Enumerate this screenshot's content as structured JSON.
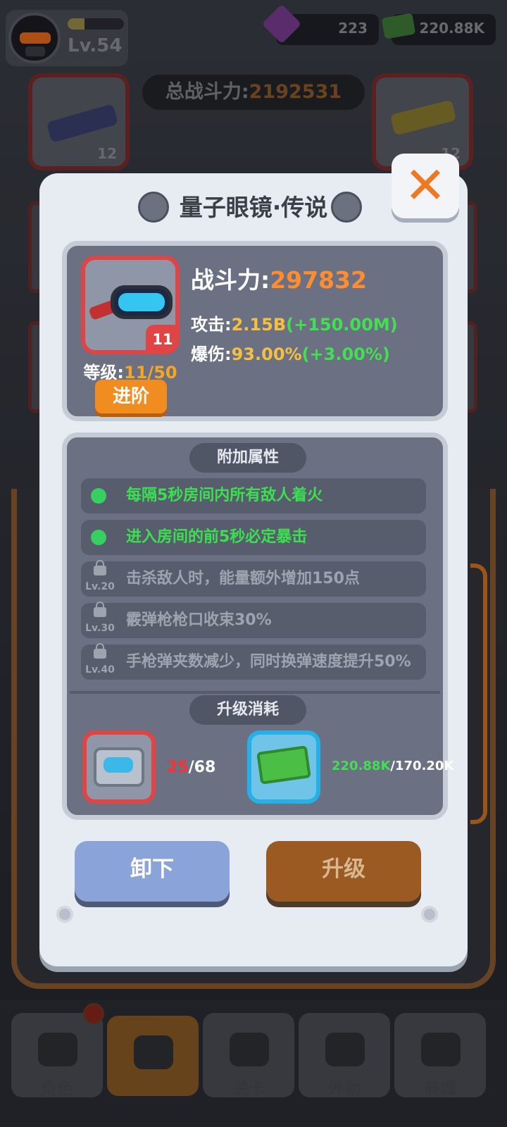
{
  "hud": {
    "player_level": "Lv.54",
    "gems": "223",
    "cash": "220.88K",
    "total_power_label": "总战斗力:",
    "total_power_value": "2192531",
    "slot_left_level": "12",
    "slot_right_level": "12"
  },
  "modal": {
    "title": "量子眼镜·传说",
    "item_level_badge": "11",
    "grade_label": "等级:",
    "grade_value": "11/50",
    "advance_label": "进阶",
    "power_label": "战斗力:",
    "power_value": "297832",
    "stats": [
      {
        "label": "攻击:",
        "value": "2.15B",
        "increase": "(+150.00M)"
      },
      {
        "label": "爆伤:",
        "value": "93.00%",
        "increase": "(+3.00%)"
      }
    ],
    "attributes_title": "附加属性",
    "attributes": [
      {
        "text": "每隔5秒房间内所有敌人着火",
        "unlocked": true,
        "unlock_level": ""
      },
      {
        "text": "进入房间的前5秒必定暴击",
        "unlocked": true,
        "unlock_level": ""
      },
      {
        "text": "击杀敌人时，能量额外增加150点",
        "unlocked": false,
        "unlock_level": "Lv.20"
      },
      {
        "text": "霰弹枪枪口收束30%",
        "unlocked": false,
        "unlock_level": "Lv.30"
      },
      {
        "text": "手枪弹夹数减少，同时换弹速度提升50%",
        "unlocked": false,
        "unlock_level": "Lv.40"
      }
    ],
    "cost_title": "升级消耗",
    "costs": [
      {
        "icon": "goggles-crate-icon",
        "have": "25",
        "need": "/68"
      },
      {
        "icon": "cash-stack-icon",
        "have": "220.88K",
        "need": "/170.20K"
      }
    ],
    "unequip_label": "卸下",
    "upgrade_label": "升级",
    "close_symbol": "✕"
  },
  "nav": {
    "tabs": [
      {
        "label": "角色",
        "active": false
      },
      {
        "label": "• 装备 •",
        "active": true
      },
      {
        "label": "关卡",
        "active": false
      },
      {
        "label": "外勤",
        "active": false
      },
      {
        "label": "商城",
        "active": false
      }
    ]
  },
  "colors": {
    "accent_orange": "#f08c20",
    "rarity_red": "#e04444",
    "stat_green": "#40e050",
    "stat_gold": "#f5c040"
  }
}
